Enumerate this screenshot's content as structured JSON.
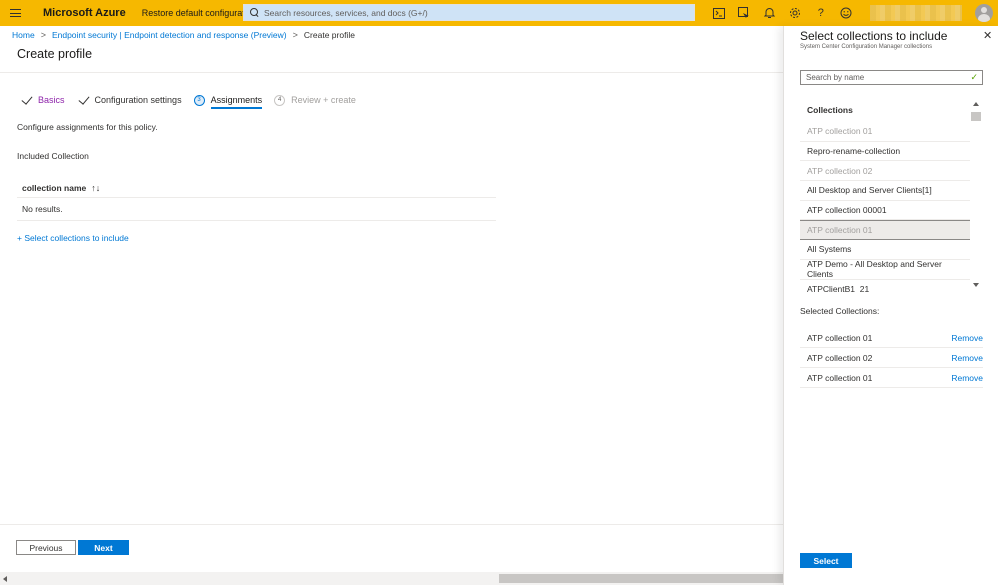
{
  "topbar": {
    "brand": "Microsoft Azure",
    "restore": "Restore default configuration",
    "search_placeholder": "Search resources, services, and docs (G+/)",
    "icons": [
      "cloud-shell-icon",
      "directory-filter-icon",
      "notifications-icon",
      "settings-icon",
      "help-icon",
      "feedback-icon"
    ]
  },
  "breadcrumb": {
    "home": "Home",
    "endpoint": "Endpoint security | Endpoint detection and response (Preview)",
    "current": "Create profile"
  },
  "page": {
    "title": "Create profile",
    "steps": [
      {
        "label": "Basics",
        "state": "done"
      },
      {
        "label": "Configuration settings",
        "state": "done"
      },
      {
        "num": "3",
        "label": "Assignments",
        "state": "active"
      },
      {
        "num": "4",
        "label": "Review + create",
        "state": "pending"
      }
    ],
    "description": "Configure assignments for this policy.",
    "included_label": "Included Collection",
    "table": {
      "column": "collection name",
      "sort_glyph": "↑↓",
      "empty": "No results."
    },
    "add_link": "+ Select collections to include",
    "previous": "Previous",
    "next": "Next"
  },
  "panel": {
    "title": "Select collections to include",
    "subtitle": "System Center Configuration Manager collections",
    "search_placeholder": "Search by name",
    "collections_header": "Collections",
    "collections": [
      {
        "name": "ATP collection 01",
        "dim": true
      },
      {
        "name": "Repro-rename-collection",
        "dim": false
      },
      {
        "name": "ATP collection 02",
        "dim": true
      },
      {
        "name": "All Desktop and Server Clients[1]",
        "dim": false
      },
      {
        "name": "ATP collection 00001",
        "dim": false
      },
      {
        "name": "ATP collection 01",
        "dim": true,
        "selected": true
      },
      {
        "name": "All Systems",
        "dim": false
      },
      {
        "name": "ATP Demo - All Desktop and Server Clients",
        "dim": false
      },
      {
        "name": "ATPClientB1_21",
        "dim": false
      }
    ],
    "selected_label": "Selected Collections:",
    "selected": [
      {
        "name": "ATP collection 01",
        "action": "Remove"
      },
      {
        "name": "ATP collection 02",
        "action": "Remove"
      },
      {
        "name": "ATP collection 01",
        "action": "Remove"
      }
    ],
    "select_button": "Select"
  }
}
